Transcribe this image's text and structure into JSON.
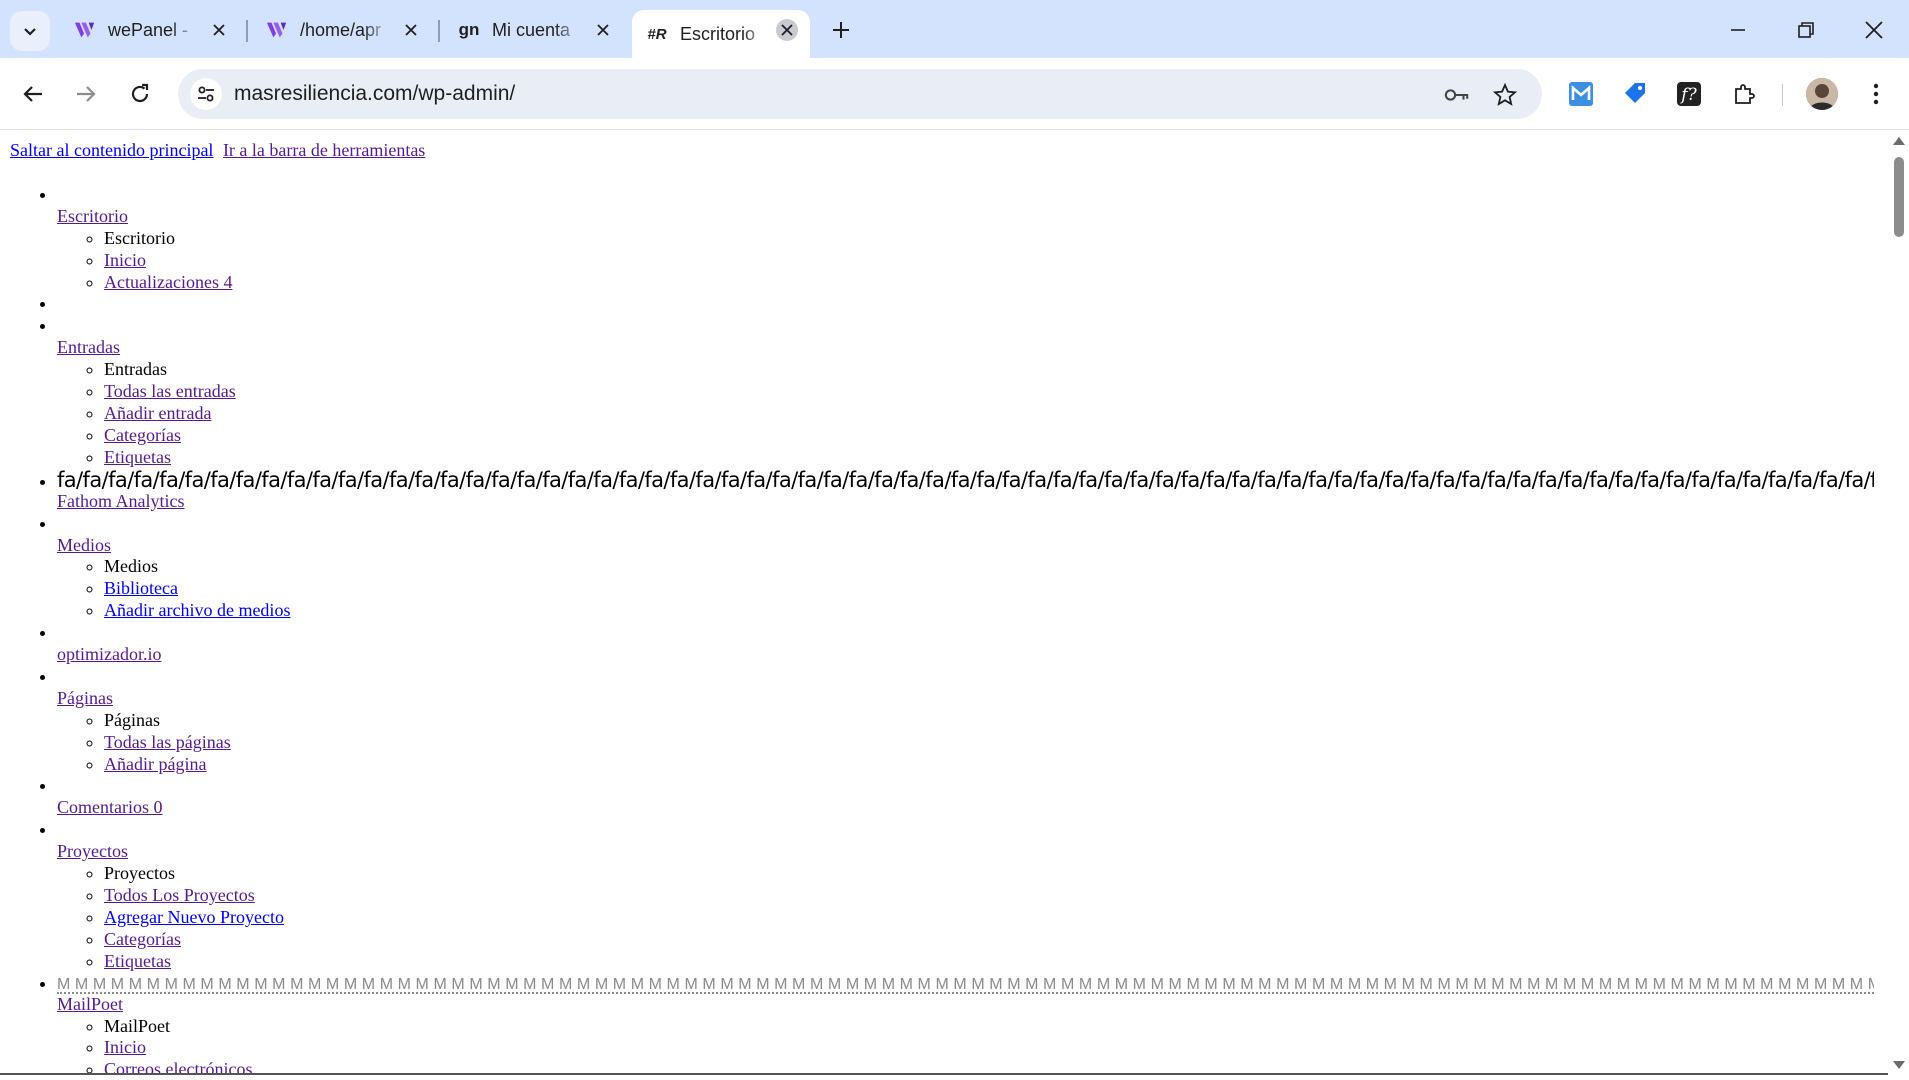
{
  "browser": {
    "tabs": [
      {
        "title": "wePanel - ",
        "favicon": "wepanel-logo-icon",
        "active": false
      },
      {
        "title": "/home/apr",
        "favicon": "wepanel-logo-icon",
        "active": false
      },
      {
        "title": "Mi cuenta ",
        "favicon": "gn-logo-icon",
        "favicon_text": "gn",
        "active": false
      },
      {
        "title": "Escritorio ",
        "favicon": "masresiliencia-logo-icon",
        "favicon_text": "#R",
        "active": true
      }
    ],
    "url": "masresiliencia.com/wp-admin/"
  },
  "page": {
    "skip_links": [
      "Saltar al contenido principal",
      "Ir a la barra de herramientas"
    ],
    "menu": {
      "escritorio": {
        "label": "Escritorio",
        "sub_heading": "Escritorio",
        "items": [
          "Inicio",
          "Actualizaciones 4"
        ]
      },
      "entradas": {
        "label": "Entradas",
        "sub_heading": "Entradas",
        "items": [
          "Todas las entradas",
          "Añadir entrada",
          "Categorías",
          "Etiquetas"
        ]
      },
      "fathom": {
        "glyphs": "fa/fa/fa/fa/fa/fa/fa/fa/fa/fa/fa/fa/fa/fa/fa/fa/fa/fa/fa/fa/fa/fa/fa/fa/fa/fa/fa/fa/fa/fa/fa/fa/fa/fa/fa/fa/fa/fa/fa/fa/fa/fa/fa/fa/fa/fa/fa/fa/fa/fa/fa/fa/fa/fa/fa/fa/fa/fa/fa/fa/fa/fa/fa/fa/fa/fa/fa/fa/fa/fa/fa/fa/fa/fa/fa/fa/fa/fa/fa/f",
        "label": "Fathom Analytics"
      },
      "medios": {
        "label": "Medios",
        "sub_heading": "Medios",
        "items": [
          "Biblioteca",
          "Añadir archivo de medios"
        ]
      },
      "optimizador": {
        "label": "optimizador.io"
      },
      "paginas": {
        "label": "Páginas",
        "sub_heading": "Páginas",
        "items": [
          "Todas las páginas",
          "Añadir página"
        ]
      },
      "comentarios": {
        "label": "Comentarios 0"
      },
      "proyectos": {
        "label": "Proyectos",
        "sub_heading": "Proyectos",
        "items": [
          "Todos Los Proyectos",
          "Agregar Nuevo Proyecto",
          "Categorías",
          "Etiquetas"
        ]
      },
      "mailpoet": {
        "glyphs": "MMMMMMMMMMMMMMMMMMMMMMMMMMMMMMMMMMMMMMMMMMMMMMMMMMMMMMMMMMMMMMMMMMMMMMMMMMMMMMMMMMMMMMMMMMMMMMMMMMMMMMMMMMMMMMMM",
        "label": "MailPoet",
        "sub_heading": "MailPoet",
        "items": [
          "Inicio",
          "Correos electrónicos"
        ]
      }
    }
  }
}
